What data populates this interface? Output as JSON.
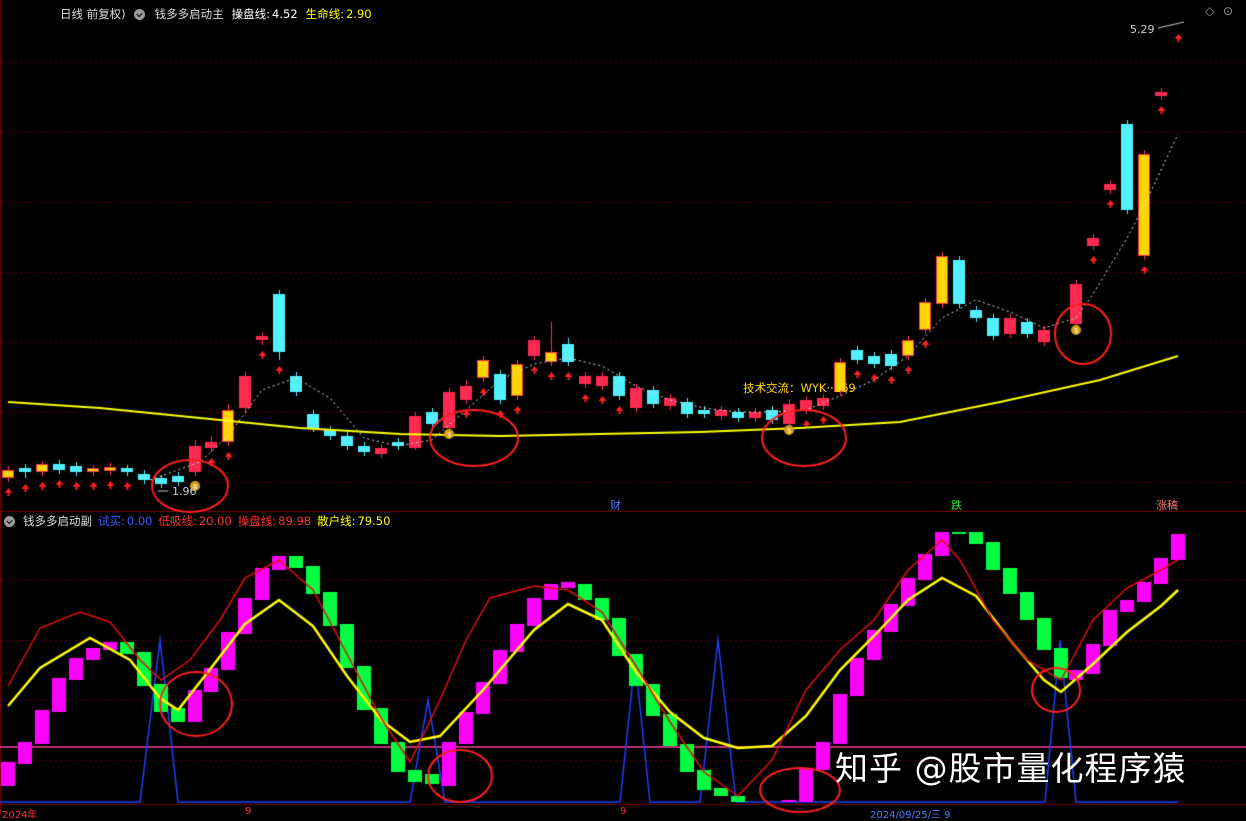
{
  "main_panel": {
    "period_label": "日线 前复权)",
    "indicator_name": "钱多多启动主",
    "line1": {
      "label": "操盘线:",
      "value": "4.52",
      "label_color": "#ffffff",
      "value_color": "#ffffff"
    },
    "line2": {
      "label": "生命线:",
      "value": "2.90",
      "label_color": "#ffff00",
      "value_color": "#ffff00"
    },
    "high_price_label": "5.29",
    "low_price_label": "1.96",
    "annotation": "技术交流：WYK··169",
    "event_labels": [
      {
        "text": "财",
        "color": "#4a7dff"
      },
      {
        "text": "跌",
        "color": "#33dd33"
      },
      {
        "text": "涨稿",
        "color": "#ff7070"
      }
    ]
  },
  "sub_panel": {
    "indicator_name": "钱多多启动副",
    "line1": {
      "label": "试买:",
      "value": "0.00",
      "color": "#3a5bff"
    },
    "line2": {
      "label": "低吸线:",
      "value": "20.00",
      "color": "#ff3030"
    },
    "line3": {
      "label": "操盘线:",
      "value": "89.98",
      "color": "#ff3030"
    },
    "line4": {
      "label": "散户线:",
      "value": "79.50",
      "color": "#ffff00"
    }
  },
  "axis_labels": {
    "date1": "2024年",
    "date2": "9",
    "date3": "9",
    "date4": "2024/09/25/三 9"
  },
  "watermark": "知乎 @股市量化程序猿",
  "colors": {
    "up": "#ff2a50",
    "down": "#50f0ff",
    "yellow_body": "#ffd700",
    "life_line": "#ffff00",
    "dotted": "#dddddd",
    "ring": "#ff2020",
    "sub_up": "#ff00ff",
    "sub_down": "#00ff40"
  }
}
